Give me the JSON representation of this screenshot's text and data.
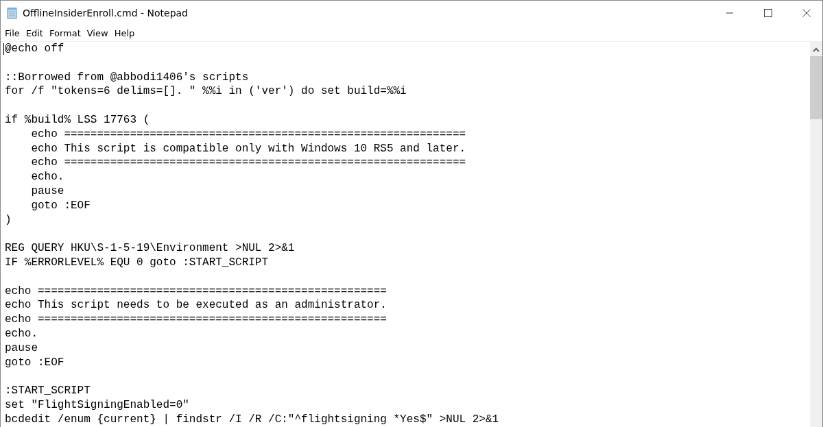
{
  "window": {
    "title": "OfflineInsiderEnroll.cmd - Notepad"
  },
  "menu": [
    "File",
    "Edit",
    "Format",
    "View",
    "Help"
  ],
  "editor": {
    "blocks": [
      [
        "@echo off"
      ],
      [
        "::Borrowed from @abbodi1406's scripts",
        "for /f \"tokens=6 delims=[]. \" %%i in ('ver') do set build=%%i"
      ],
      [
        "if %build% LSS 17763 (",
        "    echo =============================================================",
        "    echo This script is compatible only with Windows 10 RS5 and later.",
        "    echo =============================================================",
        "    echo.",
        "    pause",
        "    goto :EOF",
        ")"
      ],
      [
        "REG QUERY HKU\\S-1-5-19\\Environment >NUL 2>&1",
        "IF %ERRORLEVEL% EQU 0 goto :START_SCRIPT"
      ],
      [
        "echo =====================================================",
        "echo This script needs to be executed as an administrator.",
        "echo =====================================================",
        "echo.",
        "pause",
        "goto :EOF"
      ],
      [
        ":START_SCRIPT",
        "set \"FlightSigningEnabled=0\"",
        "bcdedit /enum {current} | findstr /I /R /C:\"^flightsigning *Yes$\" >NUL 2>&1"
      ]
    ]
  }
}
